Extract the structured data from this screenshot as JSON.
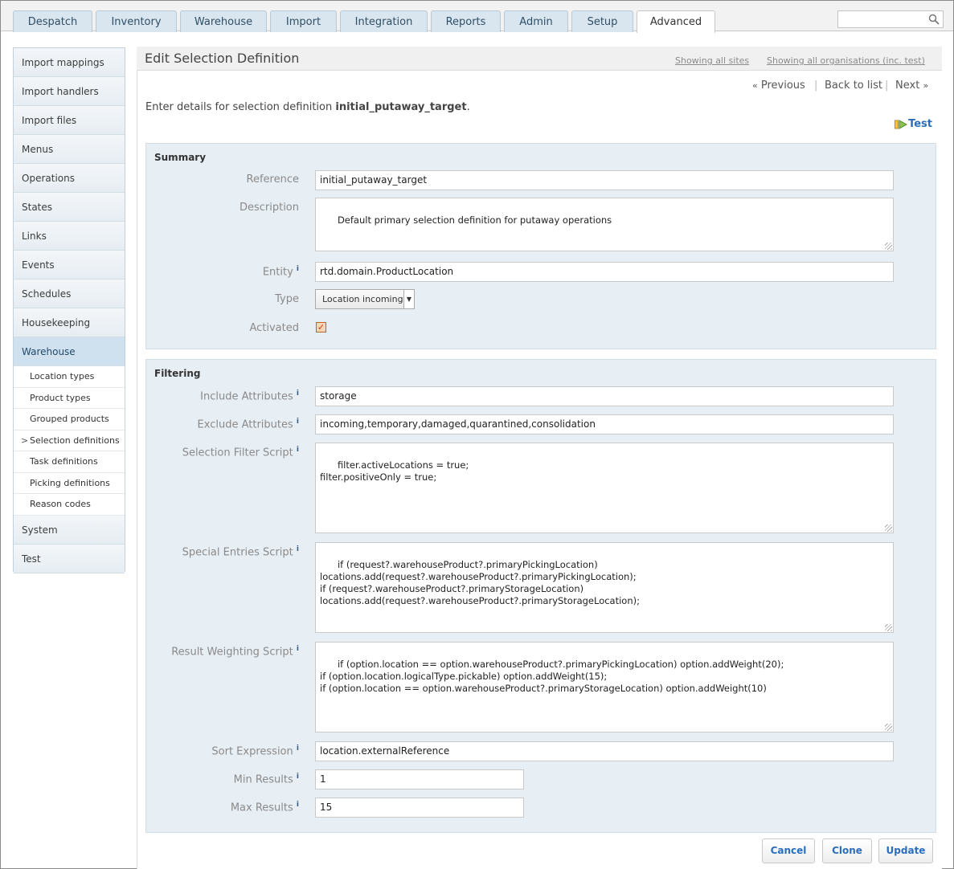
{
  "nav": {
    "tabs": [
      "Despatch",
      "Inventory",
      "Warehouse",
      "Import",
      "Integration",
      "Reports",
      "Admin",
      "Setup",
      "Advanced"
    ],
    "active_tab": "Advanced",
    "search": {
      "value": "",
      "icon": "search-icon"
    }
  },
  "sidebar": {
    "items": [
      "Import mappings",
      "Import handlers",
      "Import files",
      "Menus",
      "Operations",
      "States",
      "Links",
      "Events",
      "Schedules",
      "Housekeeping",
      "Warehouse"
    ],
    "active": "Warehouse",
    "sub_items": [
      "Location types",
      "Product types",
      "Grouped products",
      "Selection definitions",
      "Task definitions",
      "Picking definitions",
      "Reason codes"
    ],
    "active_sub": "Selection definitions",
    "after_items": [
      "System",
      "Test"
    ]
  },
  "header": {
    "title": "Edit Selection Definition",
    "sites_link": "Showing all sites",
    "orgs_link": "Showing all organisations (inc. test)"
  },
  "pager": {
    "previous": "Previous",
    "back": "Back to list",
    "next": "Next"
  },
  "intro": {
    "text": "Enter details for selection definition ",
    "name": "initial_putaway_target",
    "suffix": "."
  },
  "test_link": "Test",
  "summary": {
    "legend": "Summary",
    "reference": {
      "label": "Reference",
      "value": "initial_putaway_target"
    },
    "description": {
      "label": "Description",
      "value": "Default primary selection definition for putaway operations"
    },
    "entity": {
      "label": "Entity",
      "value": "rtd.domain.ProductLocation"
    },
    "type": {
      "label": "Type",
      "value": "Location incoming"
    },
    "activated": {
      "label": "Activated",
      "checked": true
    }
  },
  "filtering": {
    "legend": "Filtering",
    "include": {
      "label": "Include Attributes",
      "value": "storage"
    },
    "exclude": {
      "label": "Exclude Attributes",
      "value": "incoming,temporary,damaged,quarantined,consolidation"
    },
    "filter_script": {
      "label": "Selection Filter Script",
      "value": "filter.activeLocations = true;\nfilter.positiveOnly = true;"
    },
    "special_script": {
      "label": "Special Entries Script",
      "value": "if (request?.warehouseProduct?.primaryPickingLocation)\nlocations.add(request?.warehouseProduct?.primaryPickingLocation);\nif (request?.warehouseProduct?.primaryStorageLocation)\nlocations.add(request?.warehouseProduct?.primaryStorageLocation);"
    },
    "weighting_script": {
      "label": "Result Weighting Script",
      "value": "if (option.location == option.warehouseProduct?.primaryPickingLocation) option.addWeight(20);\nif (option.location.logicalType.pickable) option.addWeight(15);\nif (option.location == option.warehouseProduct?.primaryStorageLocation) option.addWeight(10)"
    },
    "sort": {
      "label": "Sort Expression",
      "value": "location.externalReference"
    },
    "min": {
      "label": "Min Results",
      "value": "1"
    },
    "max": {
      "label": "Max Results",
      "value": "15"
    }
  },
  "buttons": {
    "cancel": "Cancel",
    "clone": "Clone",
    "update": "Update"
  }
}
